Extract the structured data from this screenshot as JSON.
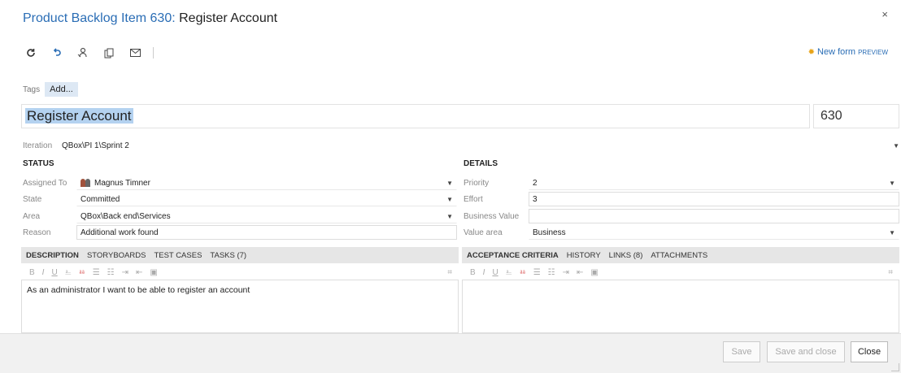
{
  "title": {
    "prefix": "Product Backlog Item 630:",
    "name": "Register Account"
  },
  "close_glyph": "×",
  "toolbar": {
    "icons": [
      "refresh-icon",
      "undo-icon",
      "link-icon",
      "copy-icon",
      "email-icon"
    ],
    "new_form_label": "New form",
    "new_form_badge": "PREVIEW"
  },
  "tags": {
    "label": "Tags",
    "add_label": "Add..."
  },
  "item": {
    "title": "Register Account",
    "id": "630"
  },
  "iteration": {
    "label": "Iteration",
    "value": "QBox\\PI 1\\Sprint 2"
  },
  "status": {
    "heading": "STATUS",
    "assigned_to": {
      "label": "Assigned To",
      "value": "Magnus Timner"
    },
    "state": {
      "label": "State",
      "value": "Committed"
    },
    "area": {
      "label": "Area",
      "value": "QBox\\Back end\\Services"
    },
    "reason": {
      "label": "Reason",
      "value": "Additional work found"
    }
  },
  "details": {
    "heading": "DETAILS",
    "priority": {
      "label": "Priority",
      "value": "2"
    },
    "effort": {
      "label": "Effort",
      "value": "3"
    },
    "business_value": {
      "label": "Business Value",
      "value": ""
    },
    "value_area": {
      "label": "Value area",
      "value": "Business"
    }
  },
  "left_tabs": [
    "DESCRIPTION",
    "STORYBOARDS",
    "TEST CASES",
    "TASKS (7)"
  ],
  "right_tabs": [
    "ACCEPTANCE CRITERIA",
    "HISTORY",
    "LINKS (8)",
    "ATTACHMENTS"
  ],
  "rte_tools": [
    "B",
    "I",
    "U",
    "⎁",
    "⎂",
    "☰",
    "☷",
    "⇥",
    "⇤",
    "▣"
  ],
  "description_text": "As an administrator I want to be able to register an account",
  "footer": {
    "save": "Save",
    "save_close": "Save and close",
    "close": "Close"
  },
  "colors": {
    "accent": "#2a6db5",
    "tab_bg": "#e6e6e6",
    "selection": "#b4d2f0"
  }
}
